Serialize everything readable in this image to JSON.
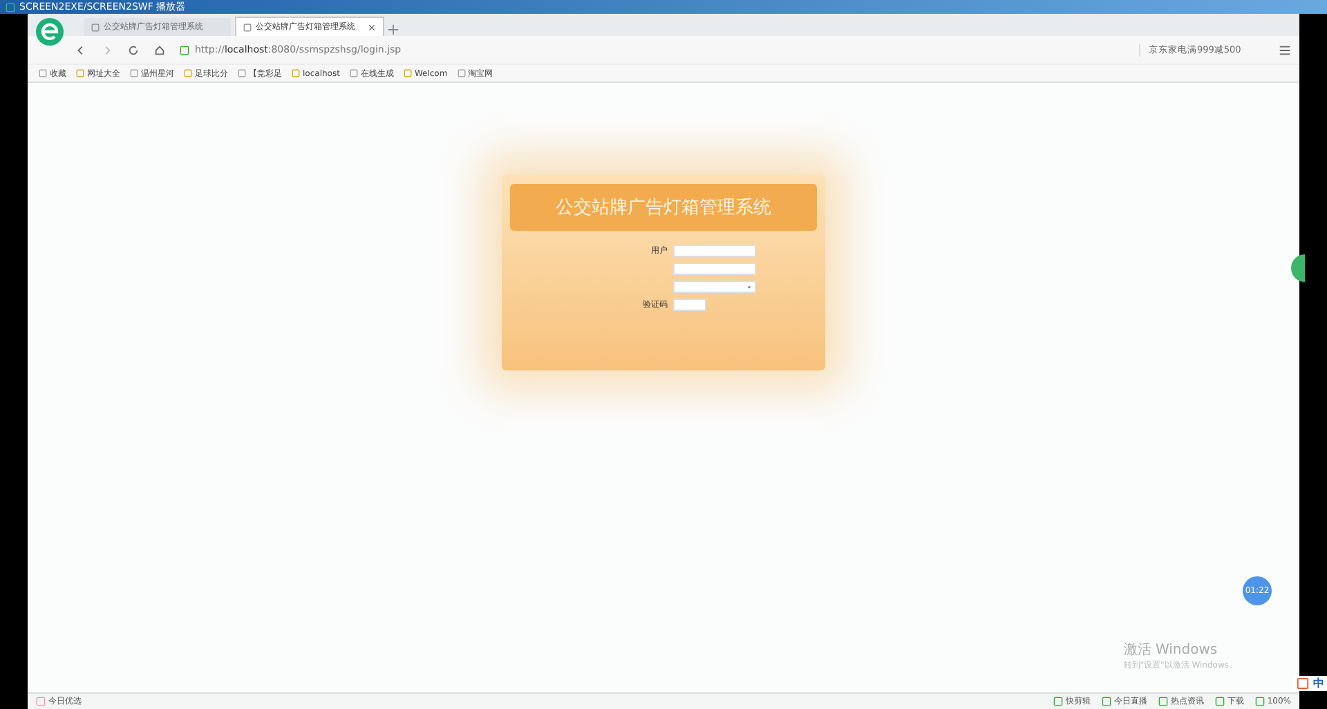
{
  "player": {
    "title": "SCREEN2EXE/SCREEN2SWF 播放器"
  },
  "tabs": [
    {
      "label": "公交站牌广告灯箱管理系统",
      "selected": false
    },
    {
      "label": "公交站牌广告灯箱管理系统",
      "selected": true
    }
  ],
  "address": {
    "prefix": "http://",
    "host": "localhost",
    "rest": ":8080/ssmspzshsg/login.jsp"
  },
  "search": {
    "value": "京东家电满999减500"
  },
  "bookmarks": [
    {
      "label": "收藏"
    },
    {
      "label": "网址大全"
    },
    {
      "label": "温州星河"
    },
    {
      "label": "足球比分"
    },
    {
      "label": "【竞彩足"
    },
    {
      "label": "localhost"
    },
    {
      "label": "在线生成"
    },
    {
      "label": "Welcom"
    },
    {
      "label": "淘宝网"
    }
  ],
  "login": {
    "title": "公交站牌广告灯箱管理系统",
    "fields": [
      {
        "kind": "text",
        "label": "用户"
      },
      {
        "kind": "text"
      },
      {
        "kind": "select"
      },
      {
        "kind": "captcha",
        "label": "验证码"
      }
    ]
  },
  "timer": "01:22",
  "activation": {
    "title": "激活 Windows",
    "hint": "转到\"设置\"以激活 Windows。"
  },
  "ime": {
    "mode": "中"
  },
  "status_left": "今日优选",
  "status_right": [
    {
      "label": "快剪辑"
    },
    {
      "label": "今日直播"
    },
    {
      "label": "热点资讯"
    },
    {
      "label": "下载"
    },
    {
      "label": "100%"
    }
  ]
}
